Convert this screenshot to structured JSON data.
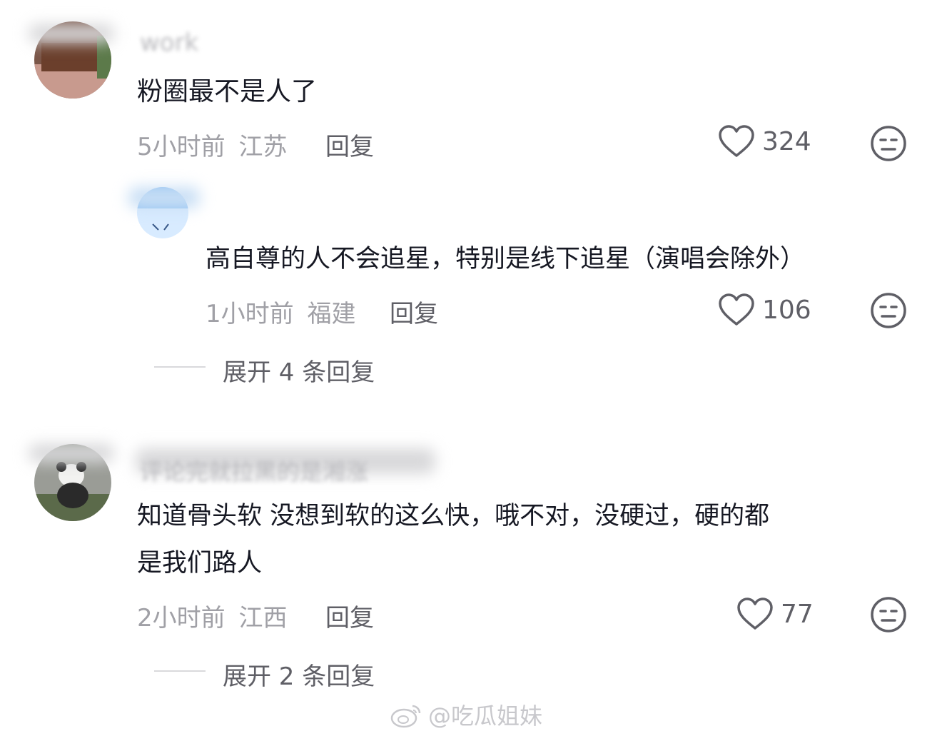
{
  "comments": [
    {
      "username": "work",
      "text": "粉圈最不是人了",
      "time": "5小时前",
      "location": "江苏",
      "reply_label": "回复",
      "likes": "324"
    },
    {
      "username": "",
      "text": "高自尊的人不会追星，特别是线下追星（演唱会除外）",
      "time": "1小时前",
      "location": "福建",
      "reply_label": "回复",
      "likes": "106",
      "expand_label": "展开 4 条回复"
    },
    {
      "username": "评论完就拉黑的是湘涨",
      "text_line1": "知道骨头软 没想到软的这么快，哦不对，没硬过，硬的都",
      "text_line2": "是我们路人",
      "time": "2小时前",
      "location": "江西",
      "reply_label": "回复",
      "likes": "77",
      "expand_label": "展开 2 条回复"
    }
  ],
  "watermark": "@吃瓜姐妹",
  "colors": {
    "primary_text": "#161823",
    "meta_text": "#a0a0a6",
    "action_text": "#5f5f66"
  }
}
